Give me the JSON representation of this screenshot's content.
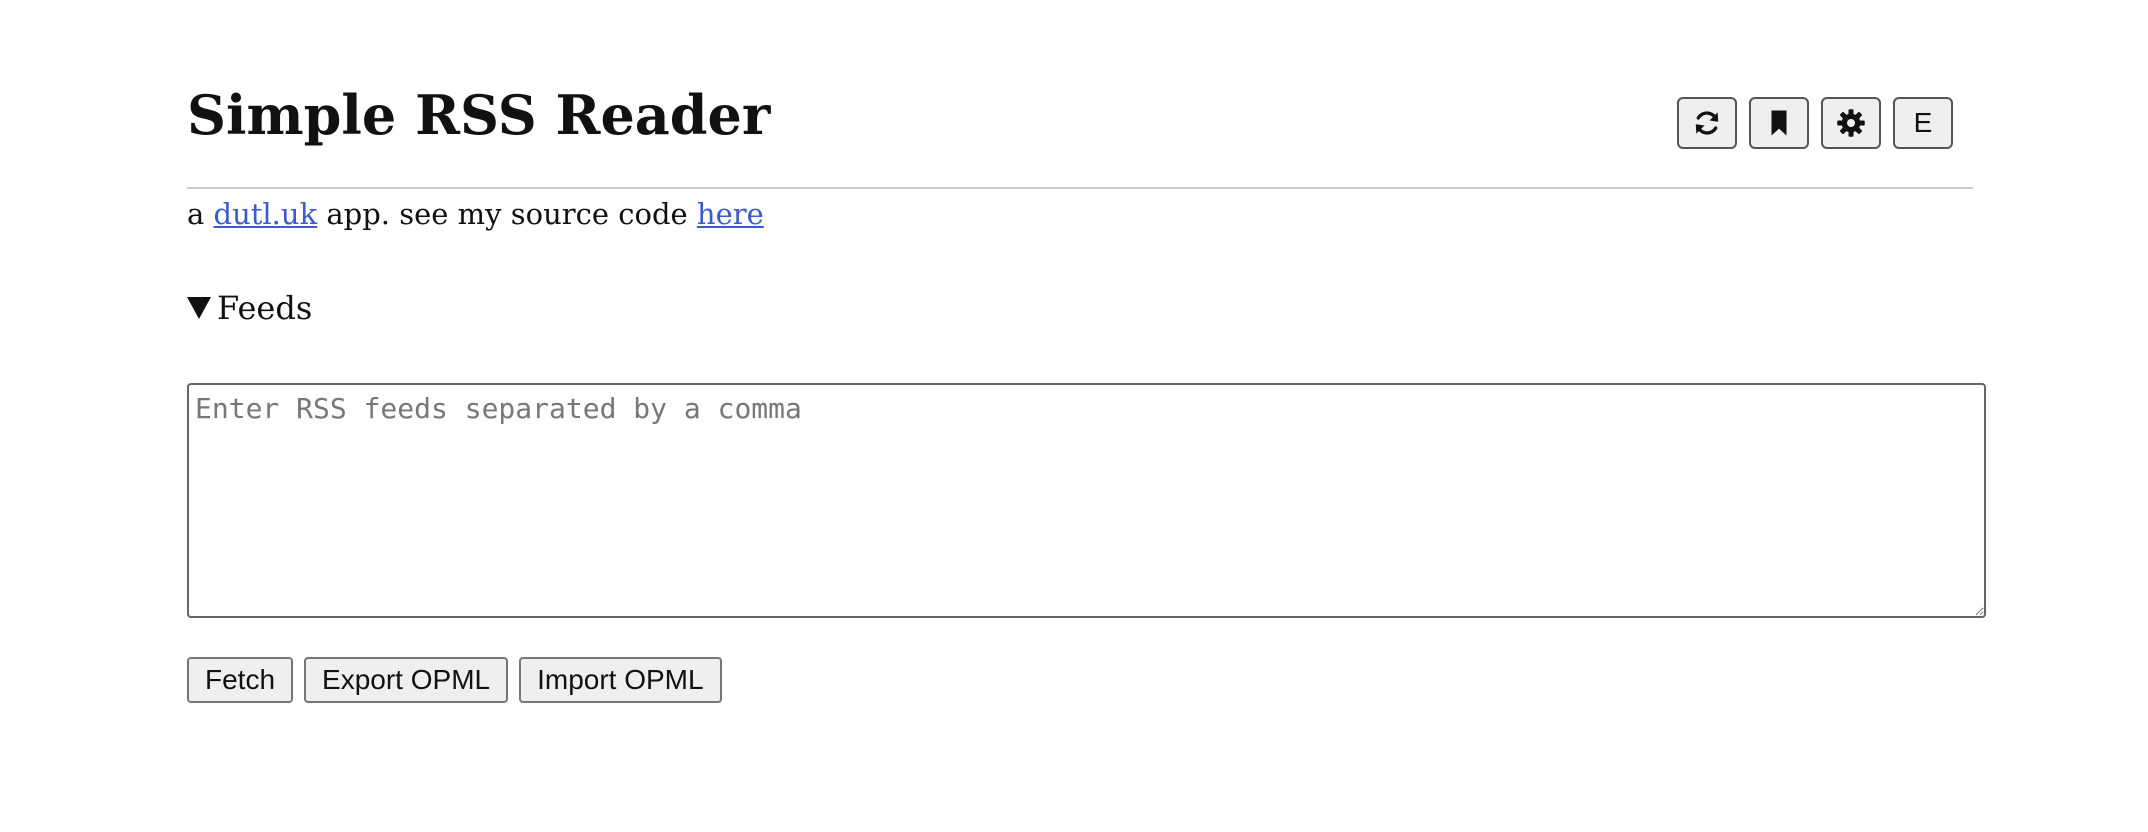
{
  "header": {
    "title": "Simple RSS Reader",
    "toolbar": {
      "refresh_icon": "refresh-icon",
      "bookmark_icon": "bookmark-icon",
      "settings_icon": "gear-icon",
      "e_label": "E"
    }
  },
  "tagline": {
    "prefix": "a ",
    "site_link": "dutl.uk",
    "middle": " app. see my source code ",
    "source_link": "here"
  },
  "feeds": {
    "summary_label": "Feeds",
    "input": {
      "value": "",
      "placeholder": "Enter RSS feeds separated by a comma"
    },
    "buttons": {
      "fetch": "Fetch",
      "export": "Export OPML",
      "import": "Import OPML"
    }
  },
  "colors": {
    "link": "#3a5bcc",
    "text": "#111111",
    "button_bg": "#efefef",
    "divider": "#cccccc"
  }
}
